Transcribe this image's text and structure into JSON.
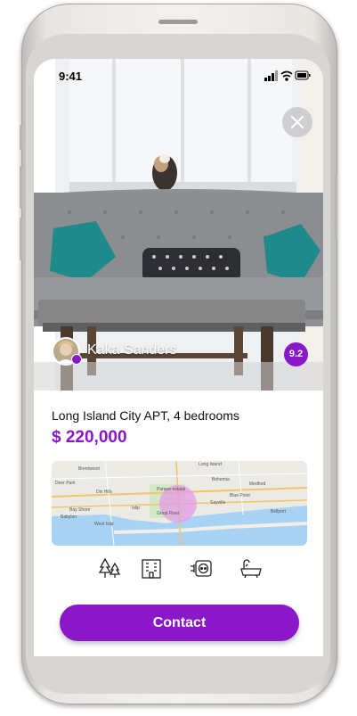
{
  "status_bar": {
    "time": "9:41"
  },
  "listing": {
    "agent_name": "Kaka Sanders",
    "score": "9.2",
    "title": "Long Island City APT, 4 bedrooms",
    "price": "$ 220,000"
  },
  "map": {
    "labels": [
      "Brentwood",
      "Long Island",
      "Deer Park",
      "Parque estatal",
      "Bohemia",
      "Medford",
      "Dix Hills",
      "Bellport",
      "Babylon",
      "Blue Point",
      "Bay Shore",
      "Islip",
      "Sayville",
      "West Islip",
      "Great River"
    ]
  },
  "amenities": [
    "trees-icon",
    "building-icon",
    "power-outlet-icon",
    "bathtub-icon"
  ],
  "actions": {
    "contact_label": "Contact"
  },
  "colors": {
    "accent": "#8A17C8",
    "map_water": "#A8D3F5",
    "map_highlight": "#E59BE8"
  }
}
